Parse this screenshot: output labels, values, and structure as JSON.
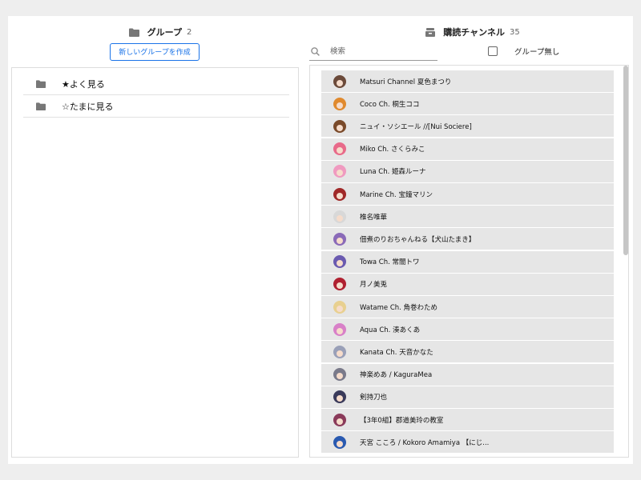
{
  "groups_header": {
    "title": "グループ",
    "count": "2",
    "icon": "folder-icon"
  },
  "new_group_button": "新しいグループを作成",
  "groups": [
    {
      "label": "★よく見る",
      "icon": "folder-icon"
    },
    {
      "label": "☆たまに見る",
      "icon": "folder-icon"
    }
  ],
  "subscriptions_header": {
    "title": "購読チャンネル",
    "count": "35",
    "icon": "inbox-icon"
  },
  "search": {
    "placeholder": "検索",
    "value": ""
  },
  "no_group_filter": {
    "label": "グループ無し",
    "checked": false
  },
  "channels": [
    {
      "name": "Matsuri Channel 夏色まつり",
      "avatar_color": "#6b4a3a"
    },
    {
      "name": "Coco Ch. 桐生ココ",
      "avatar_color": "#e08a2e"
    },
    {
      "name": "ニュイ・ソシエール //[Nui Sociere]",
      "avatar_color": "#7a4a2a"
    },
    {
      "name": "Miko Ch. さくらみこ",
      "avatar_color": "#e86a8a"
    },
    {
      "name": "Luna Ch. 姫森ルーナ",
      "avatar_color": "#f09ac0"
    },
    {
      "name": "Marine Ch. 宝鐘マリン",
      "avatar_color": "#a02828"
    },
    {
      "name": "椎名唯華",
      "avatar_color": "#d8d8d8"
    },
    {
      "name": "佃煮のりおちゃんねる【犬山たまき】",
      "avatar_color": "#8a6ab8"
    },
    {
      "name": "Towa Ch. 常闇トワ",
      "avatar_color": "#6a5ab0"
    },
    {
      "name": "月ノ美兎",
      "avatar_color": "#b02030"
    },
    {
      "name": "Watame Ch. 角巻わため",
      "avatar_color": "#e8d090"
    },
    {
      "name": "Aqua Ch. 湊あくあ",
      "avatar_color": "#d880c8"
    },
    {
      "name": "Kanata Ch. 天音かなた",
      "avatar_color": "#9aa0b8"
    },
    {
      "name": "神楽めあ / KaguraMea",
      "avatar_color": "#7a7a8a"
    },
    {
      "name": "剣持刀也",
      "avatar_color": "#3a3a5a"
    },
    {
      "name": "【3年0組】郡道美玲の教室",
      "avatar_color": "#8a3a5a"
    },
    {
      "name": "天宮 こころ / Kokoro Amamiya 【にじ...",
      "avatar_color": "#2a5ab0"
    }
  ]
}
